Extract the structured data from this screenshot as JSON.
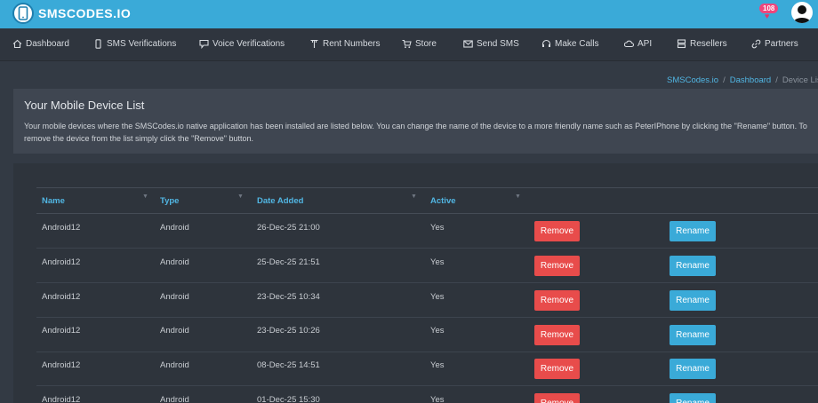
{
  "brand": {
    "name": "SMSCODES.IO"
  },
  "header": {
    "notification_count": "108"
  },
  "nav": [
    {
      "label": "Dashboard",
      "icon": "home-icon"
    },
    {
      "label": "SMS Verifications",
      "icon": "phone-icon"
    },
    {
      "label": "Voice Verifications",
      "icon": "chat-icon"
    },
    {
      "label": "Rent Numbers",
      "icon": "key-icon"
    },
    {
      "label": "Store",
      "icon": "cart-icon"
    },
    {
      "label": "Send SMS",
      "icon": "envelope-icon"
    },
    {
      "label": "Make Calls",
      "icon": "headset-icon"
    },
    {
      "label": "API",
      "icon": "cloud-icon"
    },
    {
      "label": "Resellers",
      "icon": "server-icon"
    },
    {
      "label": "Partners",
      "icon": "link-icon"
    }
  ],
  "breadcrumb": {
    "home": "SMSCodes.io",
    "dashboard": "Dashboard",
    "current": "Device Lis"
  },
  "info": {
    "title": "Your Mobile Device List",
    "text": "Your mobile devices where the SMSCodes.io native application has been installed are listed below. You can change the name of the device to a more friendly name such as PeterIPhone by clicking the \"Rename\" button. To remove the device from the list simply click the \"Remove\" button."
  },
  "table": {
    "columns": [
      "Name",
      "Type",
      "Date Added",
      "Active"
    ],
    "remove_label": "Remove",
    "rename_label": "Rename",
    "rows": [
      {
        "name": "Android12",
        "type": "Android",
        "date": "26-Dec-25 21:00",
        "active": "Yes"
      },
      {
        "name": "Android12",
        "type": "Android",
        "date": "25-Dec-25 21:51",
        "active": "Yes"
      },
      {
        "name": "Android12",
        "type": "Android",
        "date": "23-Dec-25 10:34",
        "active": "Yes"
      },
      {
        "name": "Android12",
        "type": "Android",
        "date": "23-Dec-25 10:26",
        "active": "Yes"
      },
      {
        "name": "Android12",
        "type": "Android",
        "date": "08-Dec-25 14:51",
        "active": "Yes"
      },
      {
        "name": "Android12",
        "type": "Android",
        "date": "01-Dec-25 15:30",
        "active": "Yes"
      }
    ]
  }
}
